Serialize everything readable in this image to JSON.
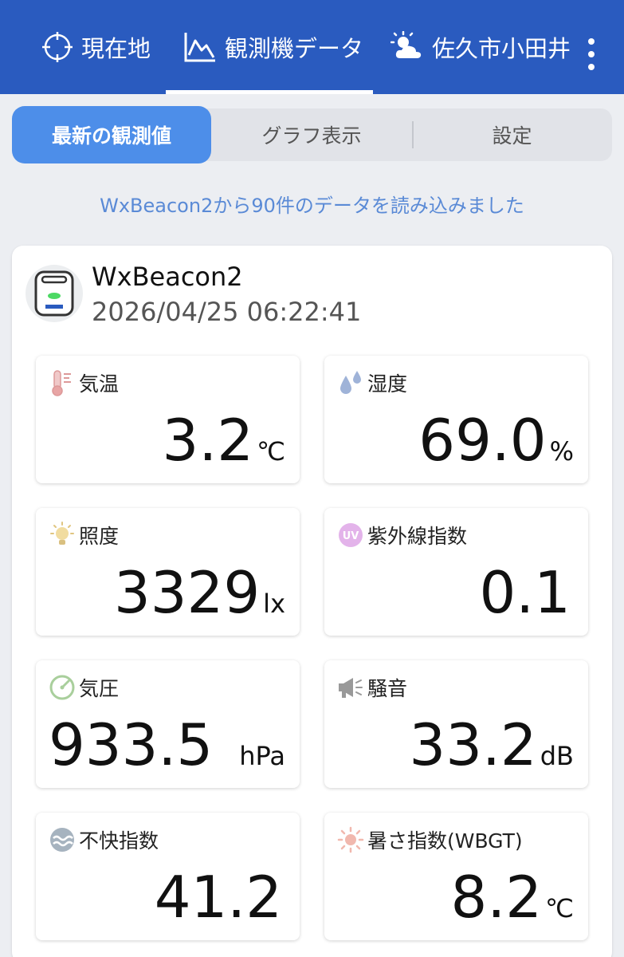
{
  "nav": {
    "tabs": [
      {
        "label": "現在地",
        "icon": "crosshair-icon"
      },
      {
        "label": "観測機データ",
        "icon": "chart-icon"
      },
      {
        "label": "佐久市小田井",
        "icon": "partly-cloudy-icon"
      }
    ],
    "active_index": 1
  },
  "segment": {
    "items": [
      "最新の観測値",
      "グラフ表示",
      "設定"
    ],
    "active_index": 0
  },
  "message": "WxBeacon2から90件のデータを読み込みました",
  "device": {
    "name": "WxBeacon2",
    "timestamp": "2026/04/25 06:22:41",
    "icon": "wxbeacon-device-icon"
  },
  "readings": [
    {
      "label": "気温",
      "value": "3.2",
      "unit": "℃",
      "icon": "thermometer-icon"
    },
    {
      "label": "湿度",
      "value": "69.0",
      "unit": "%",
      "icon": "droplets-icon"
    },
    {
      "label": "照度",
      "value": "3329",
      "unit": "lx",
      "icon": "light-bulb-icon"
    },
    {
      "label": "紫外線指数",
      "value": "0.1",
      "unit": "",
      "icon": "uv-icon"
    },
    {
      "label": "気圧",
      "value": "933.5",
      "unit": "hPa",
      "icon": "gauge-icon"
    },
    {
      "label": "騒音",
      "value": "33.2",
      "unit": "dB",
      "icon": "megaphone-icon"
    },
    {
      "label": "不快指数",
      "value": "41.2",
      "unit": "",
      "icon": "discomfort-icon"
    },
    {
      "label": "暑さ指数(WBGT)",
      "value": "8.2",
      "unit": "℃",
      "icon": "sun-icon"
    }
  ],
  "colors": {
    "header_bg": "#2a5bbf",
    "segment_active": "#4d8ee9",
    "message_text": "#5a8ad6"
  }
}
